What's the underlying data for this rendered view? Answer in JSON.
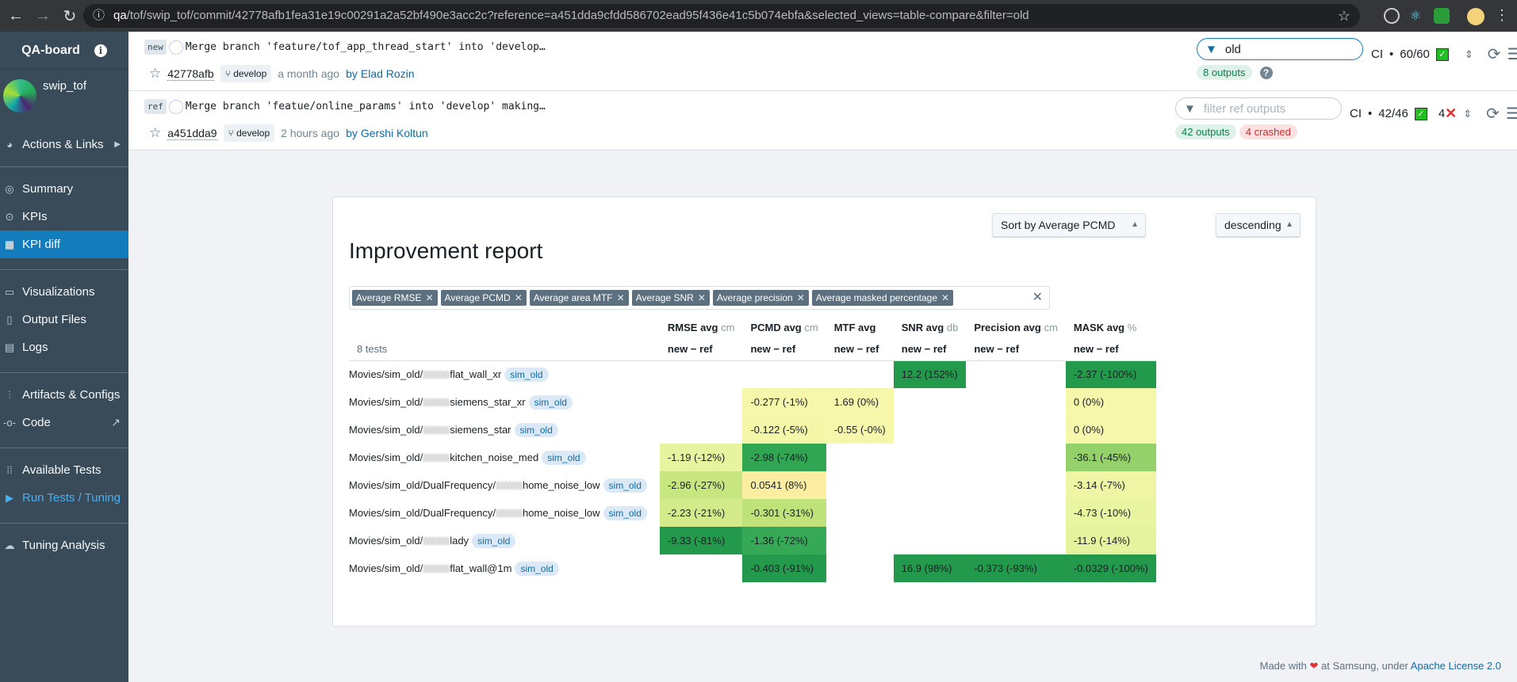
{
  "browser": {
    "url_host": "qa",
    "url_path": "/tof/swip_tof/commit/42778afb1fea31e19c00291a2a52bf490e3acc2c?reference=a451dda9cfdd586702ead95f436e41c5b074ebfa&selected_views=table-compare&filter=old"
  },
  "sidebar": {
    "brand": "QA-board",
    "project": "swip_tof",
    "items": [
      {
        "label": "Actions & Links",
        "icon": "dashboard-icon"
      },
      {
        "label": "Summary",
        "icon": "gauge-icon"
      },
      {
        "label": "KPIs",
        "icon": "target-icon"
      },
      {
        "label": "KPI diff",
        "icon": "grid-icon",
        "active": true
      },
      {
        "label": "Visualizations",
        "icon": "media-icon"
      },
      {
        "label": "Output Files",
        "icon": "document-icon"
      },
      {
        "label": "Logs",
        "icon": "console-icon"
      },
      {
        "label": "Artifacts & Configs",
        "icon": "settings-icon"
      },
      {
        "label": "Code",
        "icon": "git-commit-icon"
      },
      {
        "label": "Available Tests",
        "icon": "list-icon"
      },
      {
        "label": "Run Tests / Tuning",
        "icon": "play-icon"
      },
      {
        "label": "Tuning Analysis",
        "icon": "brain-icon"
      }
    ]
  },
  "new_commit": {
    "tag": "new",
    "message": "Merge branch 'feature/tof_app_thread_start' into 'develop…",
    "hash": "42778afb",
    "branch": "develop",
    "time": "a month ago",
    "by": "by",
    "author": "Elad Rozin",
    "filter_value": "old",
    "outputs": "8 outputs",
    "ci_label": "CI",
    "ci_count": "60/60"
  },
  "ref_commit": {
    "tag": "ref",
    "message": "Merge branch 'featue/online_params' into 'develop' making…",
    "hash": "a451dda9",
    "branch": "develop",
    "time": "2 hours ago",
    "by": "by",
    "author": "Gershi Koltun",
    "filter_placeholder": "filter ref outputs",
    "outputs": "42 outputs",
    "crashed": "4 crashed",
    "ci_label": "CI",
    "ci_count": "42/46",
    "ci_failed": "4"
  },
  "report": {
    "title": "Improvement report",
    "sort": "Sort by Average PCMD",
    "order": "descending",
    "metric_chips": [
      "Average RMSE",
      "Average PCMD",
      "Average area MTF",
      "Average SNR",
      "Average precision",
      "Average masked percentage"
    ],
    "tests_count": "8 tests",
    "diff_label": "new − ref",
    "columns": [
      {
        "name": "RMSE avg",
        "unit": "cm"
      },
      {
        "name": "PCMD avg",
        "unit": "cm"
      },
      {
        "name": "MTF avg",
        "unit": ""
      },
      {
        "name": "SNR avg",
        "unit": "db"
      },
      {
        "name": "Precision avg",
        "unit": "cm"
      },
      {
        "name": "MASK avg",
        "unit": "%"
      }
    ],
    "rows": [
      {
        "prefix": "Movies/sim_old/",
        "suffix": "flat_wall_xr",
        "tag": "sim_old",
        "cells": [
          "",
          "",
          "",
          "12.2 (152%)",
          "",
          "-2.37 (-100%)"
        ],
        "colors": [
          "",
          "",
          "",
          "#239a4b",
          "",
          "#239a4b"
        ]
      },
      {
        "prefix": "Movies/sim_old/",
        "suffix": "siemens_star_xr",
        "tag": "sim_old",
        "cells": [
          "",
          "-0.277 (-1%)",
          "1.69 (0%)",
          "",
          "",
          "0 (0%)"
        ],
        "colors": [
          "",
          "#f7f7ab",
          "#f7f7ab",
          "",
          "",
          "#f7f7ab"
        ]
      },
      {
        "prefix": "Movies/sim_old/",
        "suffix": "siemens_star",
        "tag": "sim_old",
        "cells": [
          "",
          "-0.122 (-5%)",
          "-0.55 (-0%)",
          "",
          "",
          "0 (0%)"
        ],
        "colors": [
          "",
          "#f4f6a8",
          "#f7f7ab",
          "",
          "",
          "#f7f7ab"
        ]
      },
      {
        "prefix": "Movies/sim_old/",
        "suffix": "kitchen_noise_med",
        "tag": "sim_old",
        "cells": [
          "-1.19 (-12%)",
          "-2.98 (-74%)",
          "",
          "",
          "",
          "-36.1 (-45%)"
        ],
        "colors": [
          "#e6f4a0",
          "#30a552",
          "",
          "",
          "",
          "#95d16a"
        ]
      },
      {
        "prefix": "Movies/sim_old/DualFrequency/",
        "suffix": "home_noise_low",
        "tag": "sim_old",
        "cells": [
          "-2.96 (-27%)",
          "0.0541 (8%)",
          "",
          "",
          "",
          "-3.14 (-7%)"
        ],
        "colors": [
          "#c8e680",
          "#fbeea0",
          "",
          "",
          "",
          "#eef6a6"
        ]
      },
      {
        "prefix": "Movies/sim_old/DualFrequency/",
        "suffix": "home_noise_low",
        "tag": "sim_old",
        "cells": [
          "-2.23 (-21%)",
          "-0.301 (-31%)",
          "",
          "",
          "",
          "-4.73 (-10%)"
        ],
        "colors": [
          "#d4eb8c",
          "#bfe27a",
          "",
          "",
          "",
          "#eaf5a2"
        ]
      },
      {
        "prefix": "Movies/sim_old/",
        "suffix": "lady",
        "tag": "sim_old",
        "cells": [
          "-9.33 (-81%)",
          "-1.36 (-72%)",
          "",
          "",
          "",
          "-11.9 (-14%)"
        ],
        "colors": [
          "#239a4b",
          "#36a957",
          "",
          "",
          "",
          "#e6f39e"
        ]
      },
      {
        "prefix": "Movies/sim_old/",
        "suffix": "flat_wall@1m",
        "tag": "sim_old",
        "cells": [
          "",
          "-0.403 (-91%)",
          "",
          "16.9 (98%)",
          "-0.373 (-93%)",
          "-0.0329 (-100%)"
        ],
        "colors": [
          "",
          "#239a4b",
          "",
          "#239a4b",
          "#239a4b",
          "#239a4b"
        ]
      }
    ]
  },
  "footer": {
    "made_with": "Made with",
    "at": "at Samsung, under",
    "license": "Apache License 2.0"
  }
}
